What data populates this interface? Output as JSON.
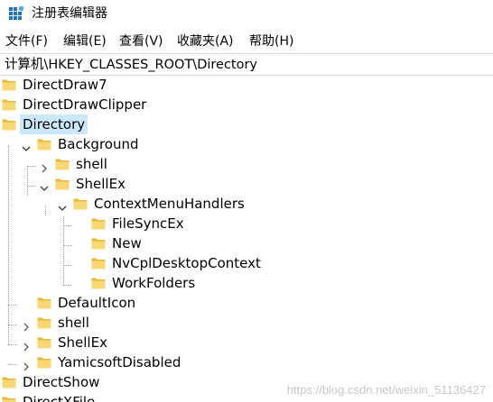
{
  "window": {
    "title": "注册表编辑器"
  },
  "menu": {
    "items": [
      {
        "label": "文件(F)"
      },
      {
        "label": "编辑(E)"
      },
      {
        "label": "查看(V)"
      },
      {
        "label": "收藏夹(A)"
      },
      {
        "label": "帮助(H)"
      }
    ]
  },
  "address": {
    "path": "计算机\\HKEY_CLASSES_ROOT\\Directory"
  },
  "tree": {
    "nodes": [
      {
        "label": "DirectDraw7",
        "expander": "none",
        "selected": false
      },
      {
        "label": "DirectDrawClipper",
        "expander": "none",
        "selected": false
      },
      {
        "label": "Directory",
        "expander": "none",
        "selected": true
      },
      {
        "label": "Background",
        "expander": "expanded",
        "selected": false
      },
      {
        "label": "shell",
        "expander": "collapsed",
        "selected": false
      },
      {
        "label": "ShellEx",
        "expander": "expanded",
        "selected": false
      },
      {
        "label": "ContextMenuHandlers",
        "expander": "expanded",
        "selected": false
      },
      {
        "label": "FileSyncEx",
        "expander": "none",
        "selected": false
      },
      {
        "label": "New",
        "expander": "none",
        "selected": false
      },
      {
        "label": "NvCplDesktopContext",
        "expander": "none",
        "selected": false
      },
      {
        "label": "WorkFolders",
        "expander": "none",
        "selected": false
      },
      {
        "label": "DefaultIcon",
        "expander": "none",
        "selected": false
      },
      {
        "label": "shell",
        "expander": "collapsed",
        "selected": false
      },
      {
        "label": "ShellEx",
        "expander": "collapsed",
        "selected": false
      },
      {
        "label": "YamicsoftDisabled",
        "expander": "collapsed",
        "selected": false
      },
      {
        "label": "DirectShow",
        "expander": "none",
        "selected": false
      },
      {
        "label": "DirectXFile",
        "expander": "none",
        "selected": false
      }
    ]
  },
  "watermark": {
    "text": "https://blog.csdn.net/weixin_51136427"
  },
  "colors": {
    "selection": "#cce8ff",
    "folder": "#f8d775",
    "folder_dark": "#e8b93c",
    "tree_lines": "#a0a0a0",
    "app_icon_blue": "#1e73be"
  }
}
